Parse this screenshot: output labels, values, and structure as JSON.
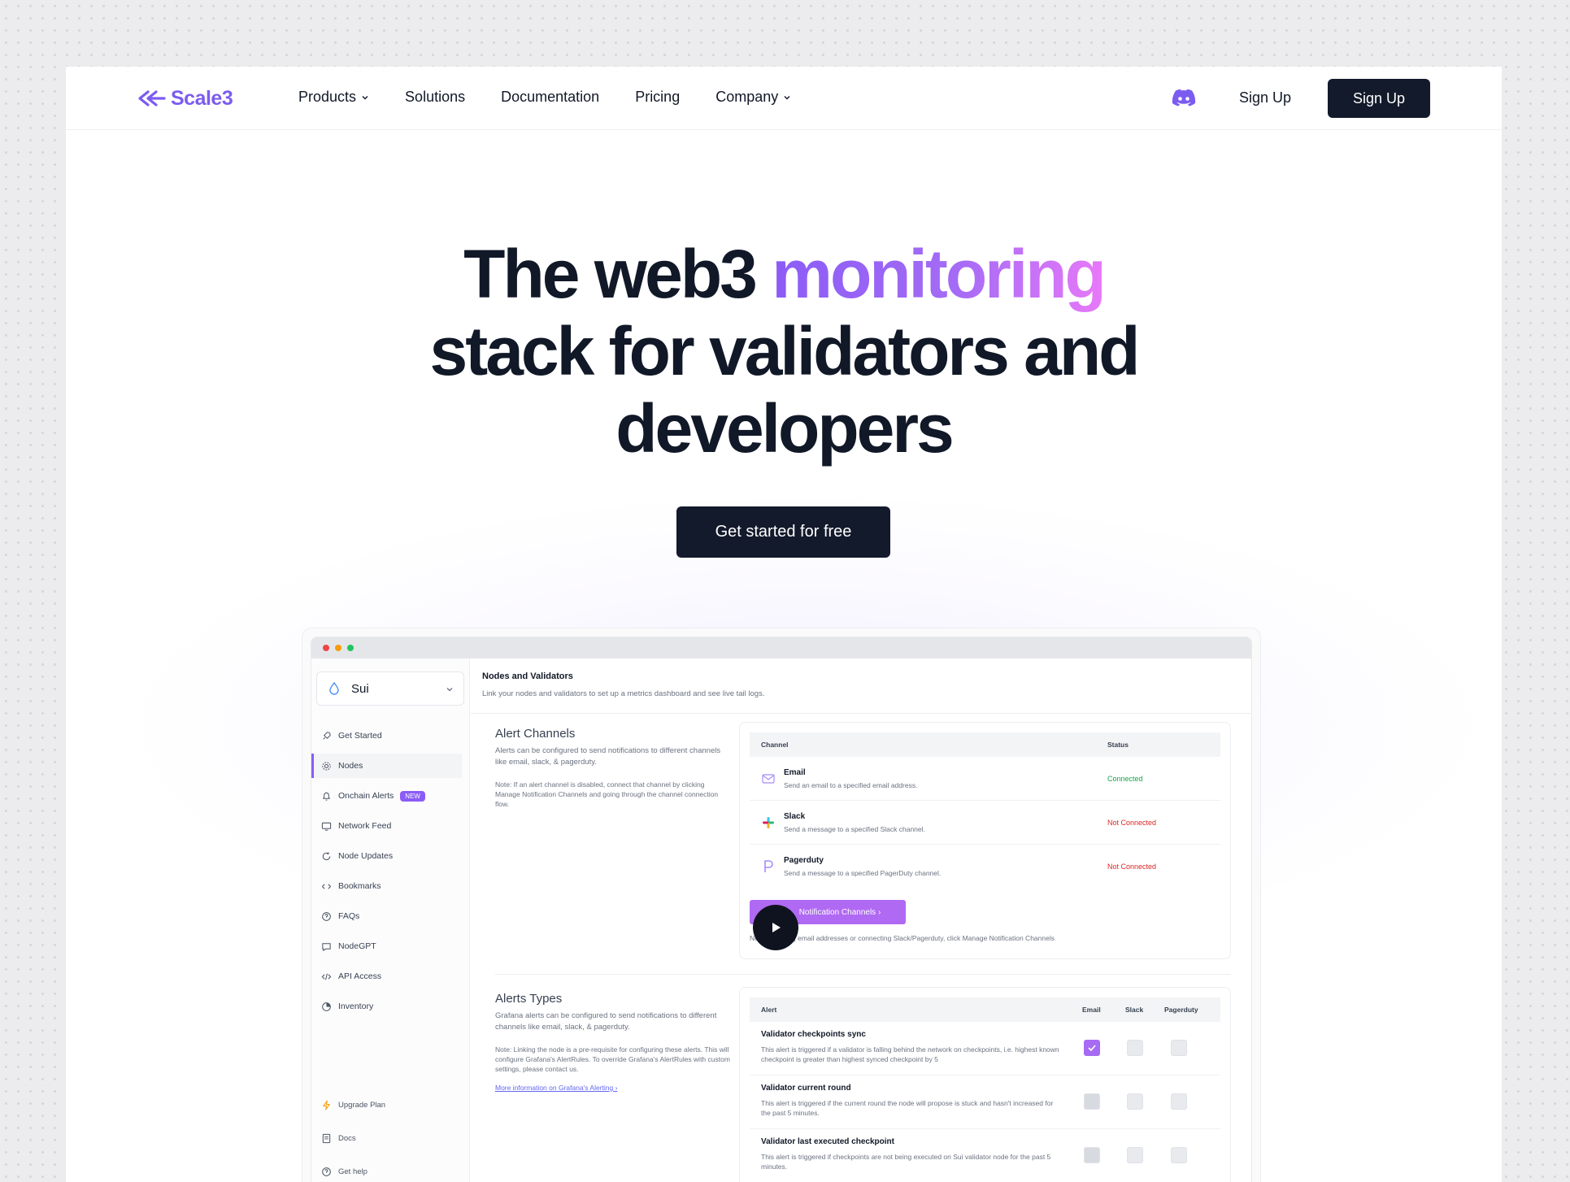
{
  "brand": {
    "name": "Scale3",
    "color": "#7c5cf0"
  },
  "nav": {
    "links": [
      {
        "label": "Products",
        "dropdown": true
      },
      {
        "label": "Solutions",
        "dropdown": false
      },
      {
        "label": "Documentation",
        "dropdown": false
      },
      {
        "label": "Pricing",
        "dropdown": false
      },
      {
        "label": "Company",
        "dropdown": true
      }
    ],
    "discord_icon": "discord-icon",
    "signin_label": "Sign Up",
    "signup_label": "Sign Up"
  },
  "hero": {
    "line1_plain": "The web3 ",
    "line1_highlight": "monitoring",
    "line2": "stack for validators and",
    "line3": "developers",
    "cta_label": "Get started for free"
  },
  "app": {
    "chain": "Sui",
    "sidebar": [
      {
        "label": "Get Started",
        "icon": "rocket-icon"
      },
      {
        "label": "Nodes",
        "icon": "nodes-icon",
        "active": true
      },
      {
        "label": "Onchain Alerts",
        "icon": "bell-icon",
        "badge": "NEW"
      },
      {
        "label": "Network Feed",
        "icon": "monitor-icon"
      },
      {
        "label": "Node Updates",
        "icon": "refresh-icon"
      },
      {
        "label": "Bookmarks",
        "icon": "bookmark-icon"
      },
      {
        "label": "FAQs",
        "icon": "help-icon"
      },
      {
        "label": "NodeGPT",
        "icon": "chat-icon"
      },
      {
        "label": "API Access",
        "icon": "code-icon"
      },
      {
        "label": "Inventory",
        "icon": "pie-icon"
      }
    ],
    "sidebar_bottom": [
      {
        "label": "Upgrade Plan",
        "icon": "bolt-icon"
      },
      {
        "label": "Docs",
        "icon": "doc-icon"
      },
      {
        "label": "Get help",
        "icon": "help-icon"
      }
    ],
    "header": {
      "title": "Nodes and Validators",
      "subtitle": "Link your nodes and validators to set up a metrics dashboard and see live tail logs."
    },
    "alert_channels": {
      "title": "Alert Channels",
      "description": "Alerts can be configured to send notifications to different channels like email, slack, & pagerduty.",
      "note": "Note: If an alert channel is disabled, connect that channel by clicking Manage Notification Channels and going through the channel connection flow.",
      "columns": [
        "Channel",
        "Status"
      ],
      "rows": [
        {
          "name": "Email",
          "desc": "Send an email to a specified email address.",
          "status": "Connected",
          "status_color": "#16a34a"
        },
        {
          "name": "Slack",
          "desc": "Send a message to a specified Slack channel.",
          "status": "Not Connected",
          "status_color": "#dc2626"
        },
        {
          "name": "Pagerduty",
          "desc": "Send a message to a specified PagerDuty channel.",
          "status": "Not Connected",
          "status_color": "#dc2626"
        }
      ],
      "button_label": "Notification Channels ›",
      "footer_note": "Ne... modifying email addresses or connecting Slack/Pagerduty, click Manage Notification Channels"
    },
    "alert_types": {
      "title": "Alerts Types",
      "description": "Grafana alerts can be configured to send notifications to different channels like email, slack, & pagerduty.",
      "note": "Note: Linking the node is a pre-requisite for configuring these alerts. This will configure Grafana's AlertRules. To override Grafana's AlertRules with custom settings, please contact us.",
      "link": "More information on Grafana's Alerting ›",
      "columns": [
        "Alert",
        "Email",
        "Slack",
        "Pagerduty"
      ],
      "rows": [
        {
          "name": "Validator checkpoints sync",
          "desc": "This alert is triggered if a validator is falling behind the network on checkpoints, i.e. highest known checkpoint is greater than highest synced checkpoint by 5",
          "email": true,
          "slack": false,
          "pagerduty": false
        },
        {
          "name": "Validator current round",
          "desc": "This alert is triggered if the current round the node will propose is stuck and hasn't increased for the past 5 minutes.",
          "email": false,
          "slack": false,
          "pagerduty": false
        },
        {
          "name": "Validator last executed checkpoint",
          "desc": "This alert is triggered if checkpoints are not being executed on Sui validator node for the past 5 minutes.",
          "email": false,
          "slack": false,
          "pagerduty": false
        }
      ]
    }
  }
}
